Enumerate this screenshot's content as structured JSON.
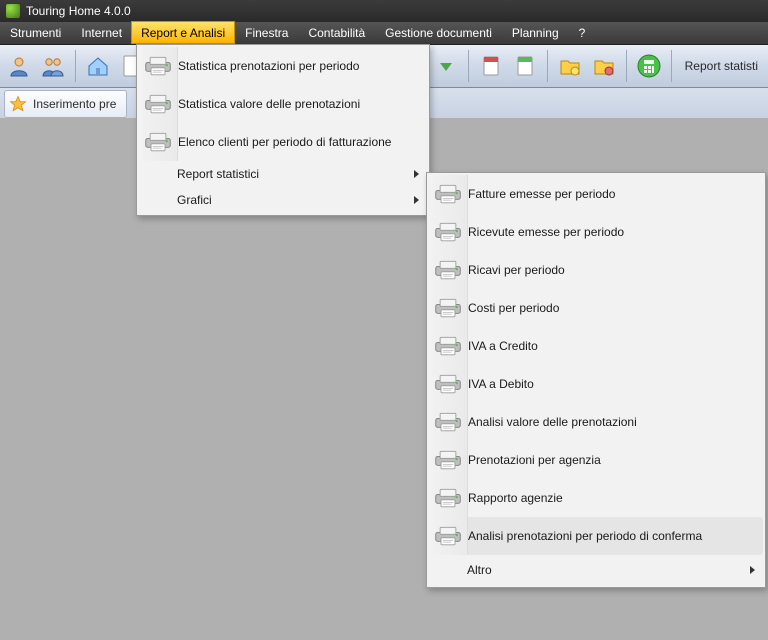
{
  "title": "Touring Home 4.0.0",
  "menubar": {
    "items": [
      {
        "label": "Strumenti"
      },
      {
        "label": "Internet"
      },
      {
        "label": "Report e Analisi",
        "open": true
      },
      {
        "label": "Finestra"
      },
      {
        "label": "Contabilità"
      },
      {
        "label": "Gestione documenti"
      },
      {
        "label": "Planning"
      },
      {
        "label": "?"
      }
    ]
  },
  "toolbar": {
    "report_label": "Report statisti"
  },
  "tabrow": {
    "tab1_label": "Inserimento pre"
  },
  "menu1": {
    "items": [
      {
        "label": "Statistica prenotazioni per periodo"
      },
      {
        "label": "Statistica valore delle prenotazioni"
      },
      {
        "label": "Elenco clienti per periodo di fatturazione"
      },
      {
        "label": "Report statistici",
        "submenu": true,
        "highlight": true
      },
      {
        "label": "Grafici",
        "submenu": true
      }
    ]
  },
  "menu2": {
    "items": [
      {
        "label": "Fatture emesse per periodo"
      },
      {
        "label": "Ricevute emesse per periodo"
      },
      {
        "label": "Ricavi per periodo"
      },
      {
        "label": "Costi per periodo"
      },
      {
        "label": "IVA a Credito"
      },
      {
        "label": "IVA a Debito"
      },
      {
        "label": "Analisi valore delle prenotazioni"
      },
      {
        "label": "Prenotazioni per agenzia"
      },
      {
        "label": "Rapporto agenzie"
      },
      {
        "label": "Analisi prenotazioni per periodo di conferma"
      }
    ],
    "altro": "Altro"
  }
}
